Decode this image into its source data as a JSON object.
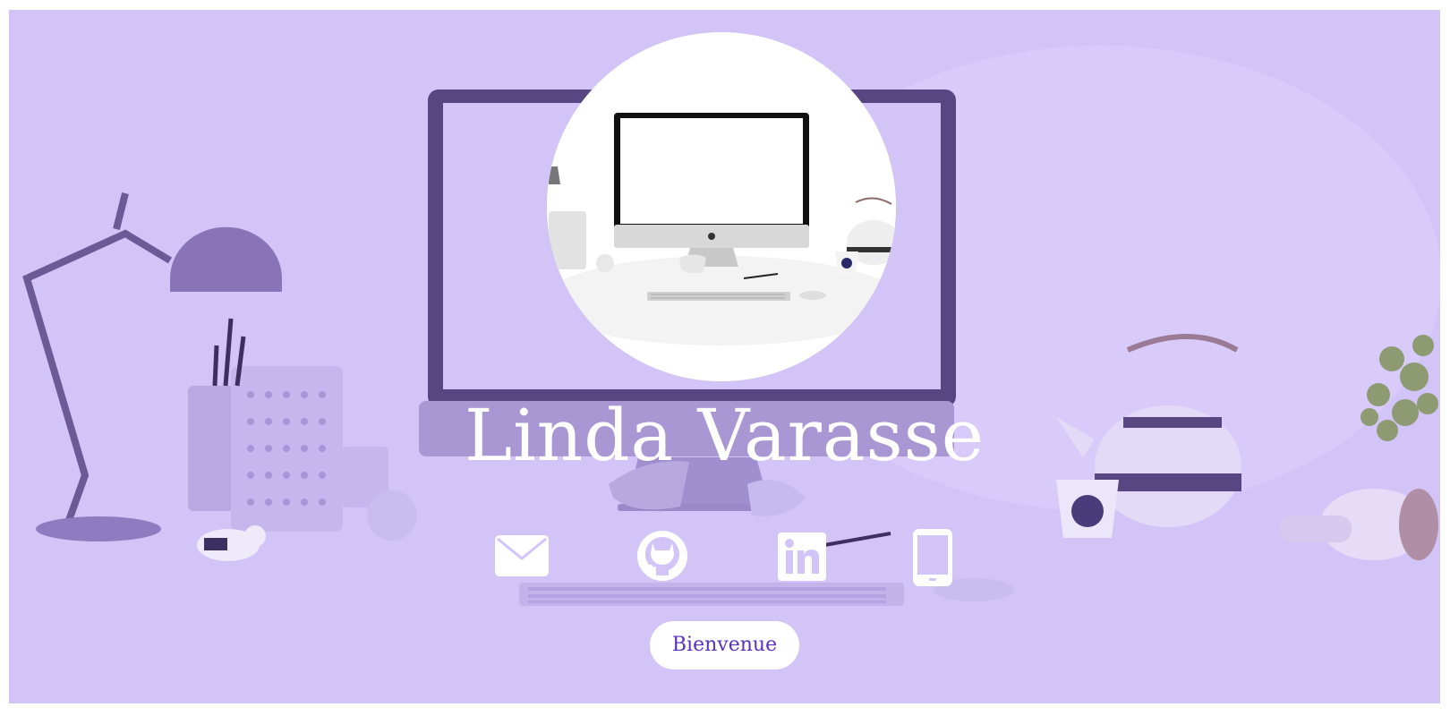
{
  "profile": {
    "name": "Linda Varasse"
  },
  "socials": [
    {
      "name": "email",
      "icon": "envelope-icon"
    },
    {
      "name": "github",
      "icon": "github-icon"
    },
    {
      "name": "linkedin",
      "icon": "linkedin-icon"
    },
    {
      "name": "phone",
      "icon": "mobile-phone-icon"
    }
  ],
  "cta": {
    "label": "Bienvenue"
  },
  "colors": {
    "background_tint": "#d3c4f8",
    "dark_purple": "#574682",
    "button_text": "#5b2fc0",
    "white": "#ffffff"
  }
}
